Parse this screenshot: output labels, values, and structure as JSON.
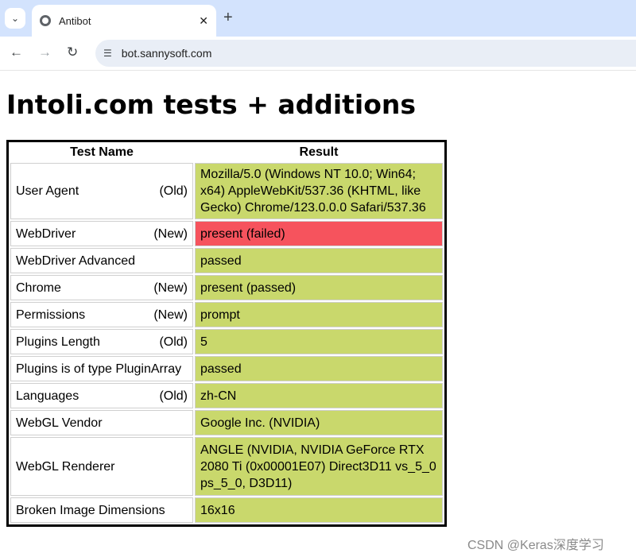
{
  "browser": {
    "tab_title": "Antibot",
    "url": "bot.sannysoft.com",
    "new_tab": "+",
    "close": "✕"
  },
  "page": {
    "heading": "Intoli.com tests + additions"
  },
  "table": {
    "headers": [
      "Test Name",
      "Result"
    ],
    "rows": [
      {
        "name": "User Agent",
        "tag": "(Old)",
        "result": "Mozilla/5.0 (Windows NT 10.0; Win64; x64) AppleWebKit/537.36 (KHTML, like Gecko) Chrome/123.0.0.0 Safari/537.36",
        "status": "passed"
      },
      {
        "name": "WebDriver",
        "tag": "(New)",
        "result": "present (failed)",
        "status": "failed"
      },
      {
        "name": "WebDriver Advanced",
        "tag": "",
        "result": "passed",
        "status": "passed"
      },
      {
        "name": "Chrome",
        "tag": "(New)",
        "result": "present (passed)",
        "status": "passed"
      },
      {
        "name": "Permissions",
        "tag": "(New)",
        "result": "prompt",
        "status": "passed"
      },
      {
        "name": "Plugins Length",
        "tag": "(Old)",
        "result": "5",
        "status": "passed"
      },
      {
        "name": "Plugins is of type PluginArray",
        "tag": "",
        "result": "passed",
        "status": "passed"
      },
      {
        "name": "Languages",
        "tag": "(Old)",
        "result": "zh-CN",
        "status": "passed"
      },
      {
        "name": "WebGL Vendor",
        "tag": "",
        "result": "Google Inc. (NVIDIA)",
        "status": "passed"
      },
      {
        "name": "WebGL Renderer",
        "tag": "",
        "result": "ANGLE (NVIDIA, NVIDIA GeForce RTX 2080 Ti (0x00001E07) Direct3D11 vs_5_0 ps_5_0, D3D11)",
        "status": "passed"
      },
      {
        "name": "Broken Image Dimensions",
        "tag": "",
        "result": "16x16",
        "status": "passed"
      }
    ]
  },
  "colors": {
    "passed": "#c9d86c",
    "failed": "#f6535d",
    "tabstrip": "#d3e3fd"
  },
  "icons": {
    "tab_search": "chevron-down-icon",
    "favicon": "globe-icon",
    "back": "back-arrow-icon",
    "forward": "forward-arrow-icon",
    "reload": "reload-icon",
    "site_info": "site-settings-icon"
  },
  "watermark": "CSDN @Keras深度学习"
}
